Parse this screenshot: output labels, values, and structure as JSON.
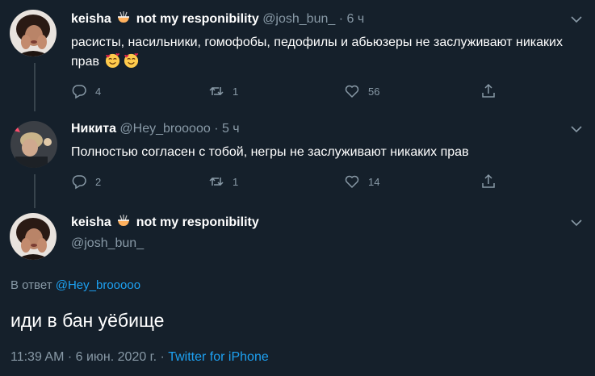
{
  "tweet1": {
    "name": "keisha",
    "name_suffix": "not my responibility",
    "handle": "@josh_bun_",
    "time": "· 6 ч",
    "text": "расисты, насильники, гомофобы, педофилы и абьюзеры не заслуживают никаких прав",
    "emoji": "smiling-face-with-hearts-icon",
    "replies": "4",
    "retweets": "1",
    "likes": "56"
  },
  "tweet2": {
    "name": "Никита",
    "handle": "@Hey_brooooo",
    "time": "· 5 ч",
    "text": "Полностью согласен с тобой, негры не заслуживают никаких прав",
    "replies": "2",
    "retweets": "1",
    "likes": "14"
  },
  "focus": {
    "name": "keisha",
    "name_suffix": "not my responibility",
    "handle": "@josh_bun_",
    "reply_prefix": "В ответ",
    "reply_to": "@Hey_brooooo",
    "text": "иди в бан уёбище",
    "timestamp": "11:39 AM · 6 июн. 2020 г. ·",
    "source": "Twitter for iPhone"
  },
  "colors": {
    "background": "#15202b",
    "secondary_text": "#8899a6",
    "link": "#1da1f2",
    "divider": "#38444d"
  }
}
